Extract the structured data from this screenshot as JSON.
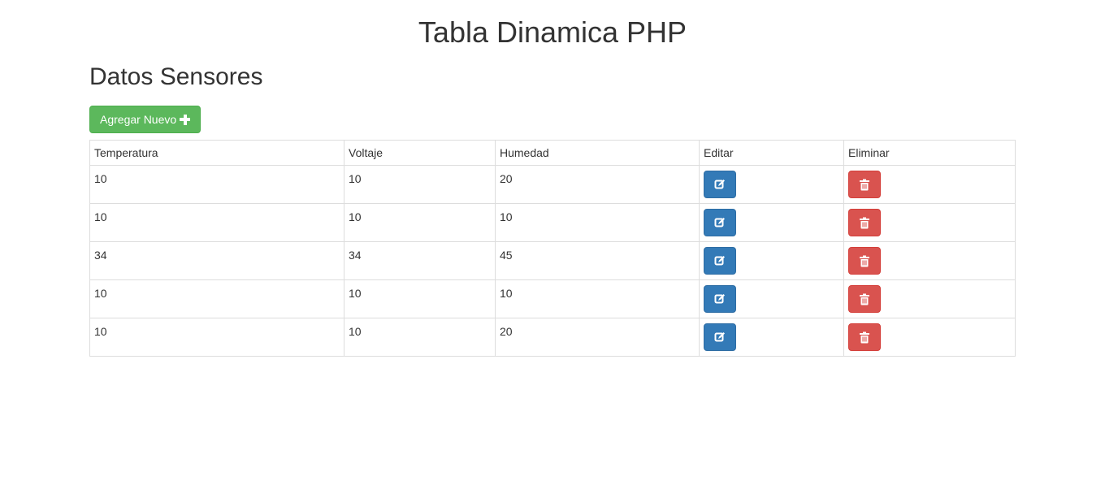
{
  "header": {
    "title": "Tabla Dinamica PHP",
    "section_title": "Datos Sensores"
  },
  "toolbar": {
    "add_label": "Agregar Nuevo",
    "add_icon": "plus-icon",
    "add_color": "#5cb85c"
  },
  "table": {
    "columns": [
      "Temperatura",
      "Voltaje",
      "Humedad",
      "Editar",
      "Eliminar"
    ],
    "rows": [
      {
        "temperatura": "10",
        "voltaje": "10",
        "humedad": "20"
      },
      {
        "temperatura": "10",
        "voltaje": "10",
        "humedad": "10"
      },
      {
        "temperatura": "34",
        "voltaje": "34",
        "humedad": "45"
      },
      {
        "temperatura": "10",
        "voltaje": "10",
        "humedad": "10"
      },
      {
        "temperatura": "10",
        "voltaje": "10",
        "humedad": "20"
      }
    ],
    "edit_icon": "edit-icon",
    "delete_icon": "trash-icon",
    "edit_color": "#337ab7",
    "delete_color": "#d9534f"
  }
}
